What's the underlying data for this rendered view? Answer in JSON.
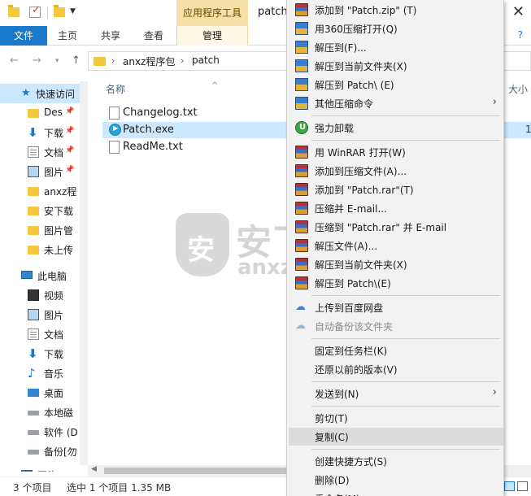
{
  "titlebar": {
    "context_tab_title": "应用程序工具",
    "window_title": "patch",
    "close_glyph": "✕"
  },
  "ribbon": {
    "file_tab": "文件",
    "tabs": [
      "主页",
      "共享",
      "查看"
    ],
    "manage_tab": "管理",
    "right_glyph": "?"
  },
  "address": {
    "segments": [
      "anxz程序包",
      "patch"
    ]
  },
  "nav_pane": {
    "items": [
      {
        "label": "快速访问",
        "icon": "star-icon"
      },
      {
        "label": "Des",
        "icon": "folder-icon",
        "pinned": true
      },
      {
        "label": "下载",
        "icon": "download-arrow-icon",
        "pinned": true
      },
      {
        "label": "文档",
        "icon": "document-icon",
        "pinned": true
      },
      {
        "label": "图片",
        "icon": "picture-icon",
        "pinned": true
      },
      {
        "label": "anxz程",
        "icon": "folder-icon"
      },
      {
        "label": "安下载",
        "icon": "folder-icon"
      },
      {
        "label": "图片管",
        "icon": "folder-icon"
      },
      {
        "label": "未上传",
        "icon": "folder-icon"
      },
      {
        "label": "此电脑",
        "icon": "computer-icon"
      },
      {
        "label": "视频",
        "icon": "video-icon"
      },
      {
        "label": "图片",
        "icon": "picture-icon"
      },
      {
        "label": "文档",
        "icon": "document-icon"
      },
      {
        "label": "下载",
        "icon": "download-arrow-icon"
      },
      {
        "label": "音乐",
        "icon": "music-icon"
      },
      {
        "label": "桌面",
        "icon": "desktop-icon"
      },
      {
        "label": "本地磁",
        "icon": "disk-icon"
      },
      {
        "label": "软件 (D",
        "icon": "disk-icon"
      },
      {
        "label": "备份[勿",
        "icon": "disk-icon"
      },
      {
        "label": "网络",
        "icon": "network-icon"
      }
    ]
  },
  "file_list": {
    "header_name": "名称",
    "header_size": "大小",
    "files": [
      {
        "name": "Changelog.txt",
        "type": "txt",
        "selected": false,
        "size": ""
      },
      {
        "name": "Patch.exe",
        "type": "exe",
        "selected": true,
        "size": "1"
      },
      {
        "name": "ReadMe.txt",
        "type": "txt",
        "selected": false,
        "size": ""
      }
    ]
  },
  "watermark": {
    "shield_char": "安",
    "text": "安下载",
    "url": "anxz.com"
  },
  "status": {
    "item_count": "3 个项目",
    "selection": "选中 1 个项目  1.35 MB"
  },
  "context_menu": {
    "items": [
      {
        "label": "添加到 \"Patch.zip\" (T)",
        "icon": "winrar-icon"
      },
      {
        "label": "用360压缩打开(Q)",
        "icon": "360zip-icon"
      },
      {
        "label": "解压到(F)...",
        "icon": "360zip-icon"
      },
      {
        "label": "解压到当前文件夹(X)",
        "icon": "360zip-icon"
      },
      {
        "label": "解压到 Patch\\ (E)",
        "icon": "360zip-icon"
      },
      {
        "label": "其他压缩命令",
        "icon": "360zip-icon",
        "submenu": true
      },
      {
        "sep": true
      },
      {
        "label": "强力卸载",
        "icon": "uninstall-icon"
      },
      {
        "sep": true
      },
      {
        "label": "用 WinRAR 打开(W)",
        "icon": "winrar-icon"
      },
      {
        "label": "添加到压缩文件(A)...",
        "icon": "winrar-icon"
      },
      {
        "label": "添加到 \"Patch.rar\"(T)",
        "icon": "winrar-icon"
      },
      {
        "label": "压缩并 E-mail...",
        "icon": "winrar-icon"
      },
      {
        "label": "压缩到 \"Patch.rar\" 并 E-mail",
        "icon": "winrar-icon"
      },
      {
        "label": "解压文件(A)...",
        "icon": "winrar-icon"
      },
      {
        "label": "解压到当前文件夹(X)",
        "icon": "winrar-icon"
      },
      {
        "label": "解压到 Patch\\(E)",
        "icon": "winrar-icon"
      },
      {
        "sep": true
      },
      {
        "label": "上传到百度网盘",
        "icon": "baidu-cloud-icon"
      },
      {
        "label": "自动备份该文件夹",
        "icon": "baidu-cloud-icon",
        "disabled": true
      },
      {
        "sep": true
      },
      {
        "label": "固定到任务栏(K)"
      },
      {
        "label": "还原以前的版本(V)"
      },
      {
        "sep": true
      },
      {
        "label": "发送到(N)",
        "submenu": true
      },
      {
        "sep": true
      },
      {
        "label": "剪切(T)"
      },
      {
        "label": "复制(C)",
        "highlight": true
      },
      {
        "sep": true
      },
      {
        "label": "创建快捷方式(S)"
      },
      {
        "label": "删除(D)"
      },
      {
        "label": "重命名(M)"
      }
    ]
  }
}
